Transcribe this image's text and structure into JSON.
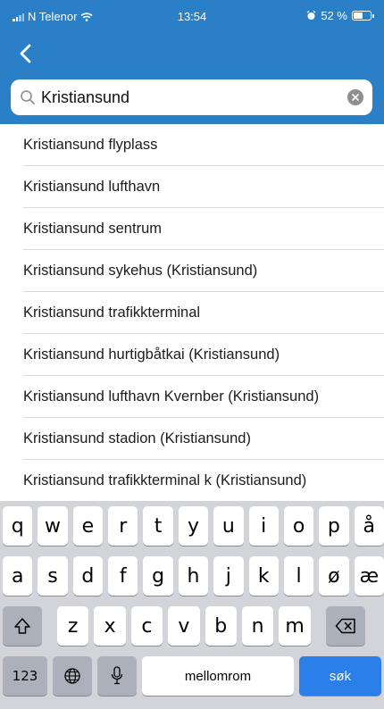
{
  "status_bar": {
    "carrier": "N Telenor",
    "time": "13:54",
    "battery": "52 %",
    "battery_level": 0.52
  },
  "nav": {
    "back_icon": "chevron-left-icon"
  },
  "search": {
    "value": "Kristiansund",
    "icon": "search-icon",
    "clear_icon": "clear-icon"
  },
  "results": [
    "Kristiansund flyplass",
    "Kristiansund lufthavn",
    "Kristiansund sentrum",
    "Kristiansund sykehus (Kristiansund)",
    "Kristiansund trafikkterminal",
    "Kristiansund hurtigbåtkai (Kristiansund)",
    "Kristiansund lufthavn Kvernber (Kristiansund)",
    "Kristiansund stadion (Kristiansund)",
    "Kristiansund trafikkterminal k (Kristiansund)"
  ],
  "keyboard": {
    "row1": [
      "q",
      "w",
      "e",
      "r",
      "t",
      "y",
      "u",
      "i",
      "o",
      "p",
      "å"
    ],
    "row2": [
      "a",
      "s",
      "d",
      "f",
      "g",
      "h",
      "j",
      "k",
      "l",
      "ø",
      "æ"
    ],
    "row3": [
      "z",
      "x",
      "c",
      "v",
      "b",
      "n",
      "m"
    ],
    "numbers_label": "123",
    "space_label": "mellomrom",
    "go_label": "søk",
    "accent_color": "#2b7fe8"
  },
  "colors": {
    "header": "#2b7fc7"
  }
}
